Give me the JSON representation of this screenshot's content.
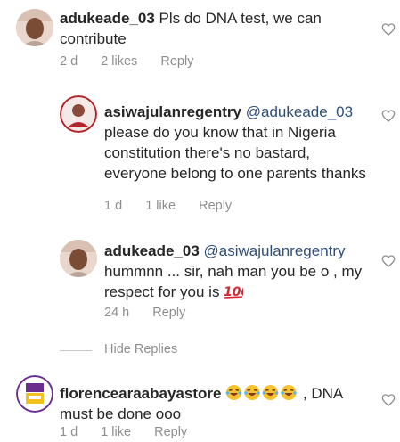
{
  "comments": [
    {
      "username": "adukeade_03",
      "text": " Pls do DNA test, we can contribute",
      "age": "2 d",
      "likes": "2 likes",
      "reply": "Reply"
    },
    {
      "username": "asiwajulanregentry",
      "mention": "@adukeade_03",
      "text": "please do you know that in Nigeria constitution there's no bastard, everyone belong to one parents thanks",
      "age": "1 d",
      "likes": "1 like",
      "reply": "Reply"
    },
    {
      "username": "adukeade_03",
      "mention": "@asiwajulanregentry",
      "text": "hummnn ... sir, nah man you be o , my respect for you is ",
      "emoji": "💯",
      "age": "24 h",
      "reply": "Reply"
    },
    {
      "username": "florencearaabayastore",
      "emoji": "😂😂😂😂",
      "text": ", DNA must be done ooo",
      "age": "1 d",
      "likes": "1 like",
      "reply": "Reply"
    }
  ],
  "hide_replies_label": "Hide Replies",
  "icons": {
    "like": "heart-outline-icon",
    "laugh": "face-with-tears-of-joy-emoji",
    "hundred": "hundred-points-emoji"
  },
  "colors": {
    "text": "#262626",
    "meta": "#8e8e8e",
    "mention": "#2f4f7a",
    "heart": "#8e8e8e"
  }
}
